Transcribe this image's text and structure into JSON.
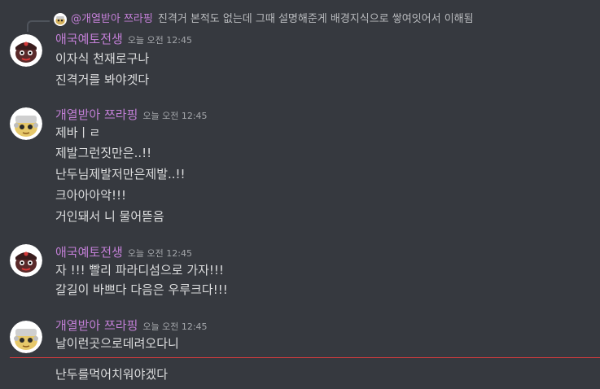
{
  "reply": {
    "author": "@개열받아 쯔라핑",
    "text": "진격거 본적도 없는데 그때 설명해준게 배경지식으로 쌓여잇어서 이해됨"
  },
  "messages": [
    {
      "author": "애국예토전생",
      "time": "오늘 오전 12:45",
      "lines": [
        "이자식 천재로구나",
        "진격거를 봐야겟다"
      ]
    },
    {
      "author": "개열받아 쯔라핑",
      "time": "오늘 오전 12:45",
      "lines": [
        "제바ㅣㄹ",
        "제발그런짓만은..!!",
        "난두님제발저만은제발..!!",
        "크아아아악!!!",
        "거인돼서 니 물어뜯음"
      ]
    },
    {
      "author": "애국예토전생",
      "time": "오늘 오전 12:45",
      "lines": [
        "자 !!! 빨리 파라디섬으로 가자!!!",
        "갈길이 바쁘다 다음은 우루크다!!!"
      ]
    },
    {
      "author": "개열받아 쯔라핑",
      "time": "오늘 오전 12:45",
      "lines": [
        "날이런곳으로데려오다니",
        "난두를먹어치워야겠다"
      ]
    }
  ],
  "colors": {
    "background": "#36393f",
    "username": "#c27fd6",
    "message_text": "#dcddde",
    "timestamp": "#a3a6aa",
    "new_messages_divider": "#d83c3e"
  },
  "icons": {
    "avatar_1": "dark-face-avatar-icon",
    "avatar_2": "yellow-face-avatar-icon"
  }
}
